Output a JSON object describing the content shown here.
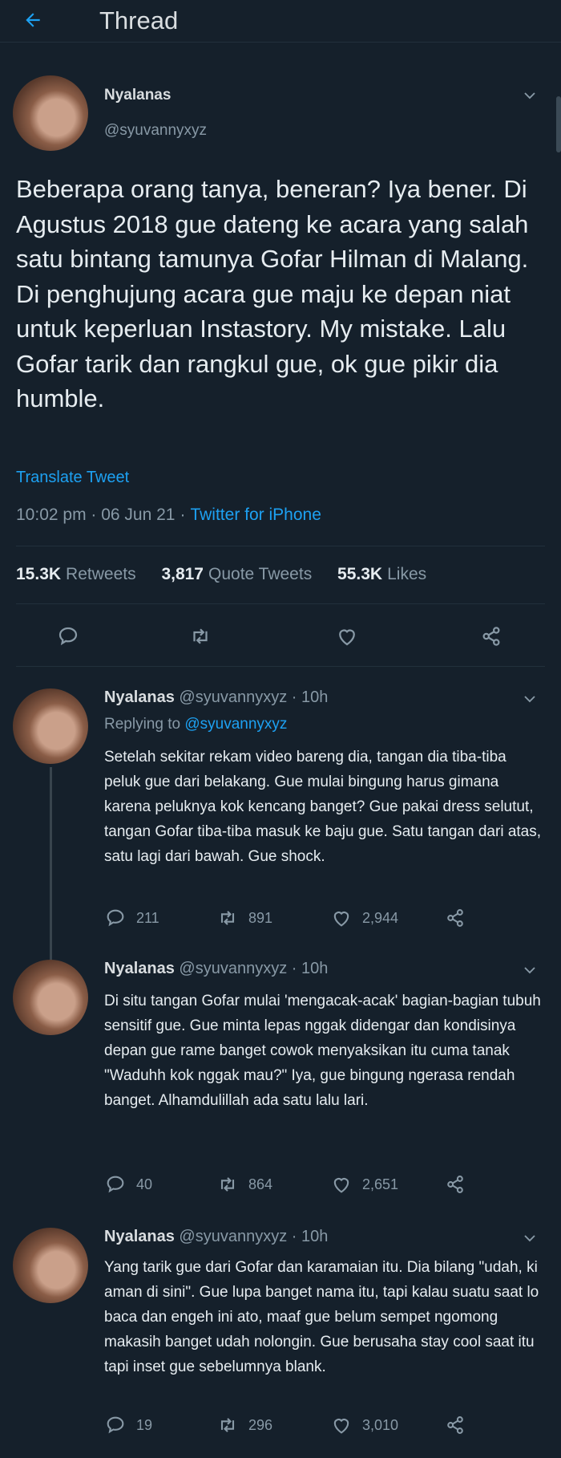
{
  "header": {
    "title": "Thread"
  },
  "main_tweet": {
    "name": "Nyalanas",
    "handle": "@syuvannyxyz",
    "text": "Beberapa orang tanya, beneran? Iya bener. Di Agustus 2018 gue dateng ke acara yang salah satu bintang tamunya Gofar Hilman di Malang. Di penghujung acara gue maju ke depan niat untuk keperluan Instastory. My mistake. Lalu Gofar tarik dan rangkul gue, ok gue pikir dia humble.",
    "translate": "Translate Tweet",
    "time": "10:02 pm · 06 Jun 21",
    "source": "Twitter for iPhone",
    "retweets_count": "15.3K",
    "retweets_label": "Retweets",
    "quotes_count": "3,817",
    "quotes_label": "Quote Tweets",
    "likes_count": "55.3K",
    "likes_label": "Likes"
  },
  "replies": [
    {
      "name": "Nyalanas",
      "handle": "@syuvannyxyz",
      "time": "10h",
      "replying_prefix": "Replying to",
      "replying_to": "@syuvannyxyz",
      "text": "Setelah sekitar rekam video bareng dia, tangan dia tiba-tiba peluk gue dari belakang. Gue mulai bingung harus gimana karena peluknya kok kencang banget? Gue pakai dress selutut, tangan Gofar tiba-tiba masuk ke baju gue. Satu tangan dari atas, satu lagi dari bawah. Gue shock.",
      "reply_count": "211",
      "retweet_count": "891",
      "like_count": "2,944"
    },
    {
      "name": "Nyalanas",
      "handle": "@syuvannyxyz",
      "time": "10h",
      "text": "Di situ tangan Gofar mulai 'mengacak-acak' bagian-bagian tubuh sensitif gue. Gue minta lepas nggak didengar dan kondisinya depan gue rame banget cowok menyaksikan itu cuma tanak \"Waduhh kok nggak mau?\" Iya, gue bingung ngerasa rendah banget. Alhamdulillah ada satu lalu lari.",
      "reply_count": "40",
      "retweet_count": "864",
      "like_count": "2,651"
    },
    {
      "name": "Nyalanas",
      "handle": "@syuvannyxyz",
      "time": "10h",
      "text": "Yang tarik gue dari Gofar dan karamaian itu. Dia bilang \"udah, ki aman di sini\". Gue lupa banget nama itu, tapi kalau suatu saat lo baca dan engeh ini ato, maaf gue belum sempet ngomong makasih banget udah nolongin. Gue berusaha stay cool saat itu tapi inset gue sebelumnya blank.",
      "reply_count": "19",
      "retweet_count": "296",
      "like_count": "3,010"
    }
  ]
}
